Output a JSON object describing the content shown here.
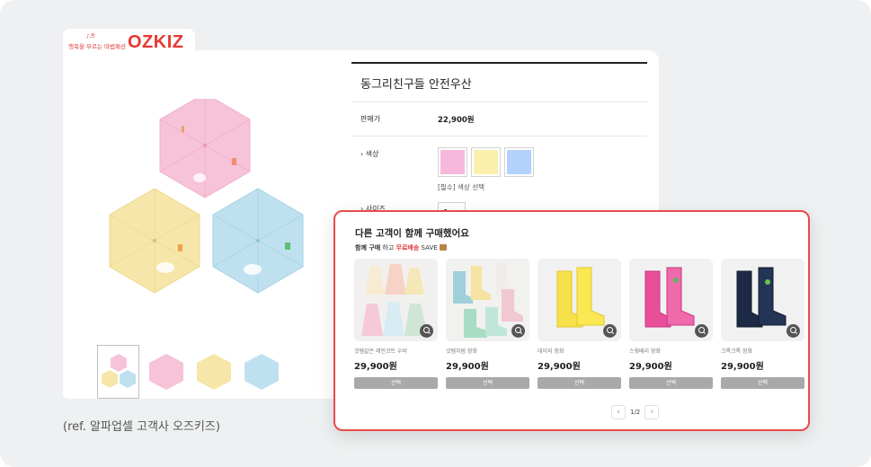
{
  "brand": {
    "tagline": "행복을 부르는 마법패션",
    "name": "OZKIZ",
    "color": "#e8382f"
  },
  "product": {
    "title": "동그리친구들 안전우산",
    "price_label": "판매가",
    "price": "22,900원",
    "color_label": "색상",
    "color_options": [
      "#f7b8dc",
      "#fbf0ab",
      "#b3d1fb"
    ],
    "color_required": "[필수] 색상 선택",
    "size_label": "사이즈",
    "size_option": "free",
    "umbrella_colors": [
      "#f6c3d9",
      "#f6e6a9",
      "#bfe0ef"
    ]
  },
  "caption": "(ref. 알파업셀 고객사 오즈키즈)",
  "upsell": {
    "title": "다른 고객이 함께 구매했어요",
    "sub_bold": "함께 구매",
    "sub_mid": " 하고 ",
    "sub_red": "무료배송",
    "sub_end": " SAVE",
    "accent": "#e84b49",
    "items": [
      {
        "name": "것템같은 레인코트 우비",
        "price": "29,900원",
        "button": "선택"
      },
      {
        "name": "것템처럼 장화",
        "price": "29,900원",
        "button": "선택"
      },
      {
        "name": "데이지 장화",
        "price": "29,900원",
        "button": "선택"
      },
      {
        "name": "스윗베리 장화",
        "price": "29,900원",
        "button": "선택"
      },
      {
        "name": "크록크록 장화",
        "price": "29,900원",
        "button": "선택"
      }
    ],
    "pagination": {
      "prev": "‹",
      "current": "1/2",
      "next": "›"
    }
  }
}
